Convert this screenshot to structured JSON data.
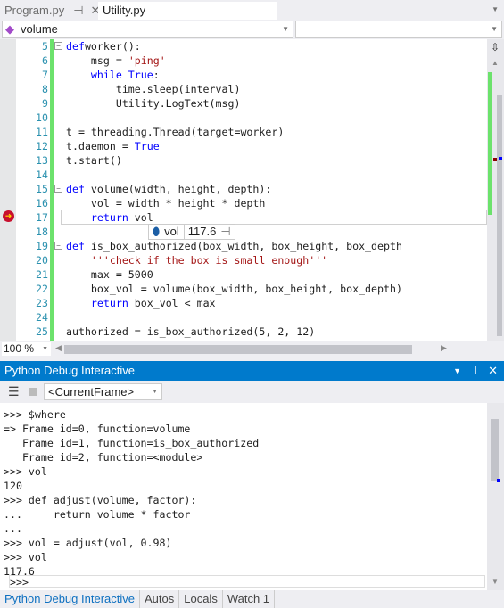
{
  "tabs": [
    {
      "label": "Program.py",
      "active": false
    },
    {
      "label": "Utility.py",
      "active": true
    }
  ],
  "nav": {
    "scope": "volume",
    "member": ""
  },
  "code_lines": [
    {
      "n": "5",
      "parts": [
        [
          "kw",
          "def"
        ],
        [
          "",
          "worker():"
        ]
      ]
    },
    {
      "n": "6",
      "parts": [
        [
          "",
          "    msg = "
        ],
        [
          "str",
          "'ping'"
        ]
      ]
    },
    {
      "n": "7",
      "parts": [
        [
          "kw",
          "    while"
        ],
        [
          "",
          ""
        ],
        [
          "kw",
          " True"
        ],
        [
          "",
          ":"
        ]
      ]
    },
    {
      "n": "8",
      "parts": [
        [
          "",
          "        time.sleep(interval)"
        ]
      ]
    },
    {
      "n": "9",
      "parts": [
        [
          "",
          "        Utility.LogText(msg)"
        ]
      ]
    },
    {
      "n": "10",
      "parts": []
    },
    {
      "n": "11",
      "parts": [
        [
          "",
          "t = threading.Thread(target=worker)"
        ]
      ]
    },
    {
      "n": "12",
      "parts": [
        [
          "",
          "t.daemon = "
        ],
        [
          "kw",
          "True"
        ]
      ]
    },
    {
      "n": "13",
      "parts": [
        [
          "",
          "t.start()"
        ]
      ]
    },
    {
      "n": "14",
      "parts": []
    },
    {
      "n": "15",
      "parts": [
        [
          "kw",
          "def"
        ],
        [
          "",
          " volume(width, height, depth):"
        ]
      ]
    },
    {
      "n": "16",
      "parts": [
        [
          "",
          "    vol = width * height * depth"
        ]
      ]
    },
    {
      "n": "17",
      "parts": [
        [
          "kw",
          "    return"
        ],
        [
          "",
          " vol"
        ]
      ]
    },
    {
      "n": "18",
      "parts": []
    },
    {
      "n": "19",
      "parts": [
        [
          "kw",
          "def"
        ],
        [
          "",
          " is_box_authorized(box_width, box_height, box_depth"
        ]
      ]
    },
    {
      "n": "20",
      "parts": [
        [
          "str",
          "    '''check if the box is small enough'''"
        ]
      ]
    },
    {
      "n": "21",
      "parts": [
        [
          "",
          "    max = 5000"
        ]
      ]
    },
    {
      "n": "22",
      "parts": [
        [
          "",
          "    box_vol = volume(box_width, box_height, box_depth)"
        ]
      ]
    },
    {
      "n": "23",
      "parts": [
        [
          "kw",
          "    return"
        ],
        [
          "",
          " box_vol < max"
        ]
      ]
    },
    {
      "n": "24",
      "parts": []
    },
    {
      "n": "25",
      "parts": [
        [
          "",
          "authorized = is_box_authorized(5, 2, 12)"
        ]
      ]
    }
  ],
  "tooltip": {
    "name": "vol",
    "value": "117.6"
  },
  "zoom": "100 %",
  "debug": {
    "title": "Python Debug Interactive",
    "frame": "<CurrentFrame>",
    "output": [
      ">>> $where",
      "=> Frame id=0, function=volume",
      "   Frame id=1, function=is_box_authorized",
      "   Frame id=2, function=<module>",
      ">>> vol",
      "120",
      ">>> def adjust(volume, factor):",
      "...     return volume * factor",
      "...",
      ">>> vol = adjust(vol, 0.98)",
      ">>> vol",
      "117.6"
    ],
    "prompt": ">>>"
  },
  "bottom_tabs": [
    "Python Debug Interactive",
    "Autos",
    "Locals",
    "Watch 1"
  ],
  "colors": {
    "accent": "#007acc",
    "keyword": "#0000ff",
    "string": "#a31515",
    "line_number": "#2b91af",
    "changed_margin": "#6ce26c"
  }
}
